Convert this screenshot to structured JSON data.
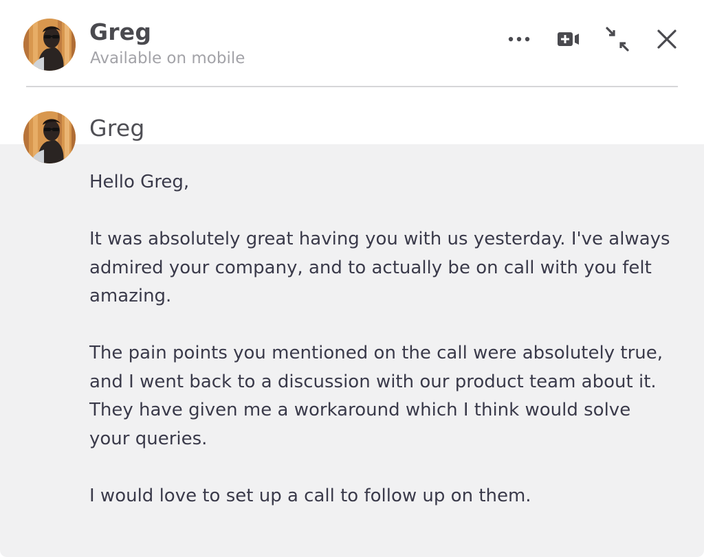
{
  "header": {
    "contact_name": "Greg",
    "status": "Available on mobile",
    "actions": [
      {
        "icon": "more-horizontal-icon"
      },
      {
        "icon": "video-call-icon"
      },
      {
        "icon": "collapse-icon"
      },
      {
        "icon": "close-icon"
      }
    ]
  },
  "message": {
    "sender": "Greg",
    "paragraphs": [
      "Hello Greg,",
      "It was absolutely great having you with us yesterday. I've always admired your company, and to actually be on call with you felt amazing.",
      "The pain points you mentioned on the call were absolutely true, and I went back to a discussion with our product team about it. They have given me a workaround which I think would solve your queries.",
      "I would love to set up a call to follow up on them."
    ]
  },
  "colors": {
    "message_background": "#f1f1f2",
    "text_primary": "#3a3a4a",
    "text_muted": "#a3a3a8",
    "icon": "#4a4a4f"
  }
}
